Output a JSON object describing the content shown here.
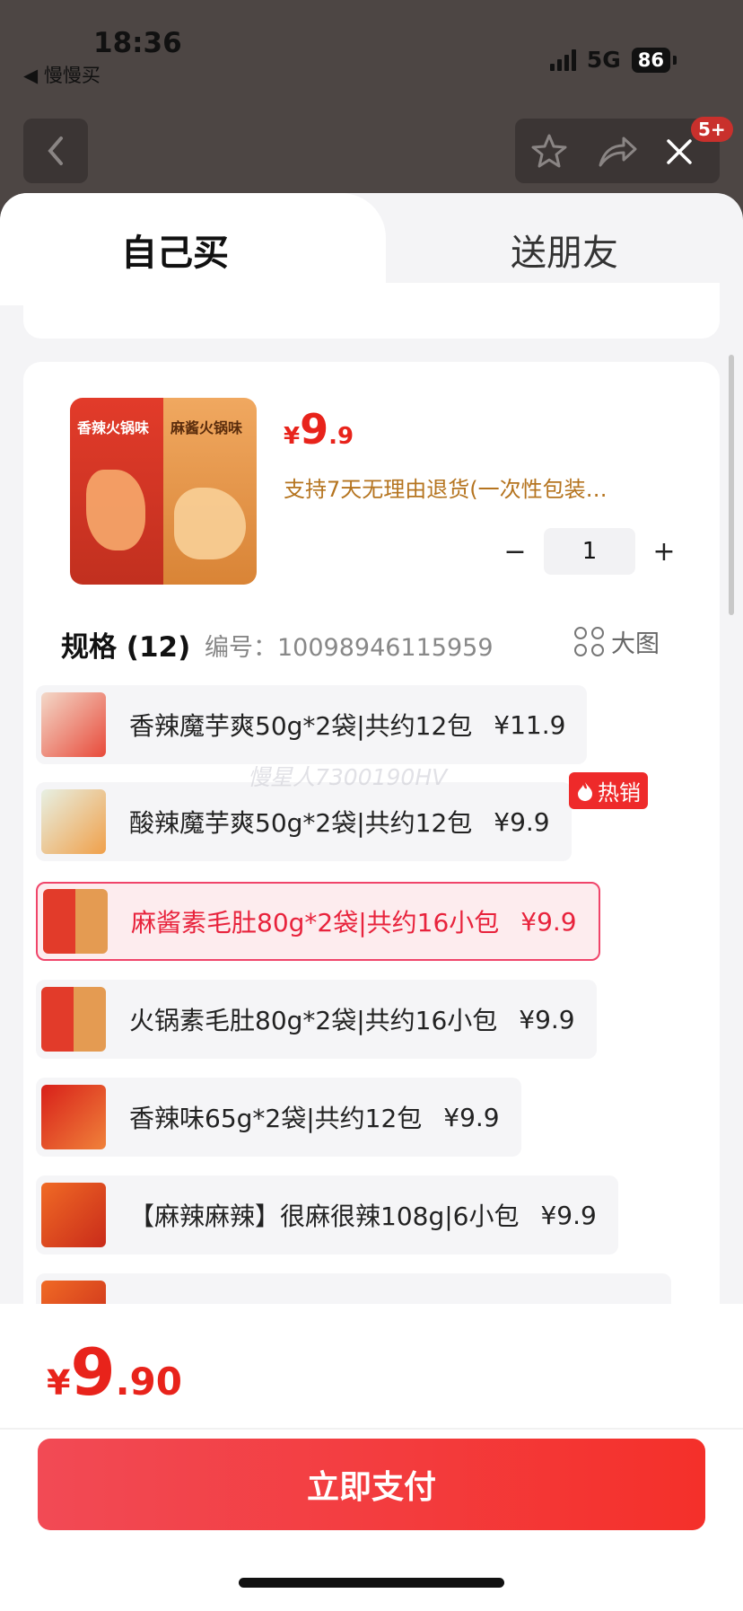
{
  "status_bar": {
    "time": "18:36",
    "back_app": "◀ 慢慢买",
    "network": "5G",
    "battery": "86"
  },
  "header": {
    "notification_badge": "5+"
  },
  "tabs": [
    {
      "label": "自己买"
    },
    {
      "label": "送朋友"
    }
  ],
  "product": {
    "price_symbol": "¥",
    "price_integer": "9",
    "price_decimal": ".9",
    "return_policy": "支持7天无理由退货(一次性包装…",
    "image_labels": [
      "香辣火锅味",
      "麻酱火锅味"
    ],
    "quantity": "1",
    "minus_label": "−",
    "plus_label": "+"
  },
  "specs": {
    "title": "规格 (12)",
    "code_label": "编号：",
    "code": "10098946115959",
    "big_image_label": "大图",
    "hot_label": "热销",
    "options": [
      {
        "name": "香辣魔芋爽50g*2袋|共约12包",
        "price": "¥11.9"
      },
      {
        "name": "酸辣魔芋爽50g*2袋|共约12包",
        "price": "¥9.9"
      },
      {
        "name": "麻酱素毛肚80g*2袋|共约16小包",
        "price": "¥9.9",
        "selected": true
      },
      {
        "name": "火锅素毛肚80g*2袋|共约16小包",
        "price": "¥9.9"
      },
      {
        "name": "香辣味65g*2袋|共约12包",
        "price": "¥9.9"
      },
      {
        "name": "【麻辣麻辣】很麻很辣108g|6小包",
        "price": "¥9.9"
      }
    ]
  },
  "watermark": "慢星人7300190HV",
  "footer": {
    "total_symbol": "¥",
    "total_integer": "9",
    "total_decimal": ".90",
    "pay_button": "立即支付"
  },
  "colors": {
    "accent": "#e8231b",
    "selected_border": "#f0456a",
    "policy": "#b5741f"
  }
}
